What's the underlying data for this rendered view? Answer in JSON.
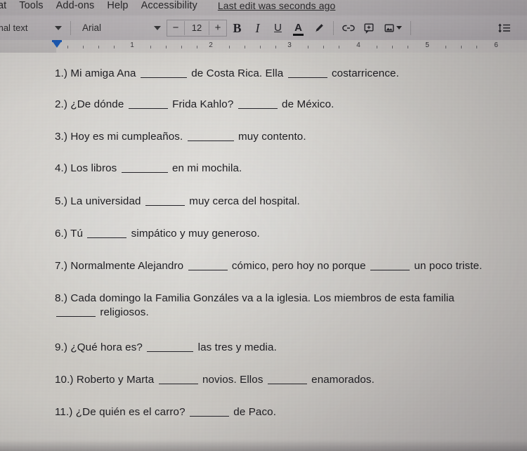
{
  "app": {
    "name": "Google Docs",
    "menu_items": [
      "at",
      "Tools",
      "Add-ons",
      "Help",
      "Accessibility"
    ],
    "last_edit": "Last edit was seconds ago"
  },
  "toolbar": {
    "paragraph_style": "mal text",
    "font_family": "Arial",
    "font_size": "12",
    "decrease_size_label": "−",
    "increase_size_label": "+",
    "bold_label": "B",
    "italic_label": "I",
    "underline_label": "U",
    "text_color_label": "A",
    "highlight_label": "highlight-pen",
    "insert_link_label": "link",
    "add_comment_label": "comment",
    "insert_image_label": "image",
    "align_left_label": "align-left",
    "align_center_label": "align-center",
    "align_right_label": "align-right",
    "align_justify_label": "align-justify",
    "line_spacing_label": "line-spacing",
    "active_accent_color": "#2a56c6"
  },
  "ruler": {
    "numbers": [
      "1",
      "2",
      "3",
      "4",
      "5",
      "6"
    ],
    "indent_marker_color": "#1b5fc1"
  },
  "document": {
    "questions": [
      {
        "number": "1.)",
        "parts": [
          "Mi amiga Ana",
          "de Costa Rica. Ella",
          "costarricence."
        ],
        "blanks": [
          "lg",
          "md"
        ]
      },
      {
        "number": "2.)",
        "parts": [
          "¿De dónde",
          "Frida Kahlo?",
          "de México."
        ],
        "blanks": [
          "md",
          "md"
        ]
      },
      {
        "number": "3.)",
        "parts": [
          "Hoy es mi cumpleaños.",
          "muy contento."
        ],
        "blanks": [
          "lg"
        ]
      },
      {
        "number": "4.)",
        "parts": [
          "Los libros",
          "en mi mochila."
        ],
        "blanks": [
          "lg"
        ]
      },
      {
        "number": "5.)",
        "parts": [
          "La universidad",
          "muy cerca del hospital."
        ],
        "blanks": [
          "md"
        ]
      },
      {
        "number": "6.)",
        "parts": [
          "Tú",
          "simpático y muy generoso."
        ],
        "blanks": [
          "md"
        ]
      },
      {
        "number": "7.)",
        "parts": [
          "Normalmente Alejandro",
          "cómico, pero hoy no porque",
          "un poco triste."
        ],
        "blanks": [
          "md",
          "md"
        ]
      },
      {
        "number": "8.)",
        "parts": [
          "Cada domingo la Familia Gonzáles va a la iglesia. Los miembros de esta familia",
          "religiosos."
        ],
        "blanks": [
          "md"
        ],
        "wrapped": true
      },
      {
        "number": "9.)",
        "parts": [
          "¿Qué hora es?",
          "las tres y media."
        ],
        "blanks": [
          "lg"
        ]
      },
      {
        "number": "10.)",
        "parts": [
          "Roberto y Marta",
          "novios. Ellos",
          "enamorados."
        ],
        "blanks": [
          "md",
          "md"
        ]
      },
      {
        "number": "11.)",
        "parts": [
          "¿De quién es el carro?",
          "de Paco."
        ],
        "blanks": [
          "md"
        ]
      }
    ]
  }
}
